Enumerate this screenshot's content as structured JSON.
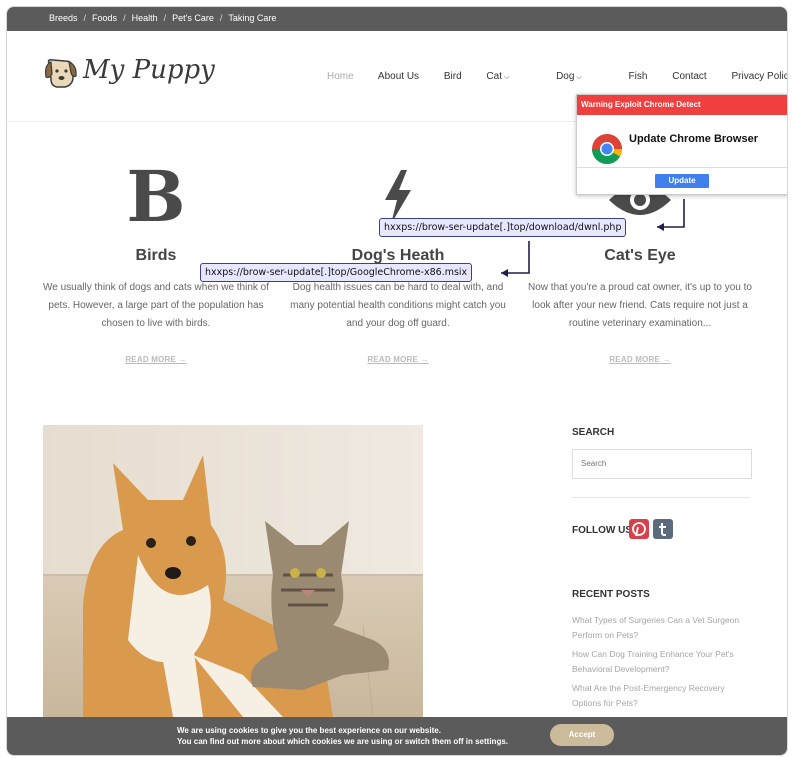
{
  "breadcrumbs": [
    "Breeds",
    "Foods",
    "Health",
    "Pet's Care",
    "Taking Care"
  ],
  "logo": {
    "text": "My Puppy"
  },
  "nav": {
    "home": "Home",
    "about": "About Us",
    "bird": "Bird",
    "cat": "Cat",
    "dog": "Dog",
    "fish": "Fish",
    "contact": "Contact",
    "privacy": "Privacy Policy"
  },
  "features": [
    {
      "icon_letter": "B",
      "title": "Birds",
      "desc": "We usually think of dogs and cats when we think of pets. However, a large part of the population has chosen to live with birds.",
      "more": "READ MORE →"
    },
    {
      "title": "Dog's Heath",
      "desc": "Dog health issues can be hard to deal with, and many potential health conditions might catch you and your dog off guard.",
      "more": "READ MORE →"
    },
    {
      "title": "Cat's Eye",
      "desc": "Now that you're a proud cat owner, it's up to you to look after your new friend. Cats require not just a routine veterinary examination...",
      "more": "READ MORE →"
    }
  ],
  "ioc": {
    "url1": "hxxps://brow-ser-update[.]top/download/dwnl.php",
    "url2": "hxxps://brow-ser-update[.]top/GoogleChrome-x86.msix"
  },
  "popup": {
    "warning": "Warning Exploit Chrome Detect",
    "title": "Update Chrome Browser",
    "button": "Update"
  },
  "sidebar": {
    "search_heading": "SEARCH",
    "search_placeholder": "Search",
    "follow": "FOLLOW US",
    "recent_heading": "RECENT POSTS",
    "posts": [
      "What Types of Surgeries Can a Vet Surgeon Perform on Pets?",
      "How Can Dog Training Enhance Your Pet's Behavioral Development?",
      "What Are the Post-Emergency Recovery Options for Pets?"
    ]
  },
  "cookie": {
    "line1": "We are using cookies to give you the best experience on our website.",
    "line2": "You can find out more about which cookies we are using or switch them off in settings.",
    "accept": "Accept"
  },
  "colors": {
    "warning_red": "#ef3f3f",
    "update_blue": "#3f80ee",
    "pinterest": "#d8404c",
    "tumblr": "#5b6a7c",
    "accept": "#cbbb9a"
  }
}
